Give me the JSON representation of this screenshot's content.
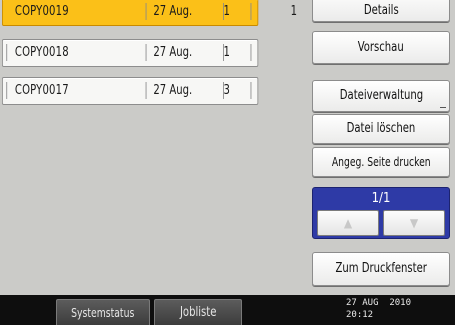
{
  "jobs": [
    {
      "name": "COPY0019",
      "date": "27 Aug.",
      "sets": "1",
      "pages": "1",
      "selected": true
    },
    {
      "name": "COPY0018",
      "date": "27 Aug.",
      "sets": "1",
      "pages": "",
      "selected": false
    },
    {
      "name": "COPY0017",
      "date": "27 Aug.",
      "sets": "3",
      "pages": "",
      "selected": false
    }
  ],
  "buttons": {
    "details": "Details",
    "preview": "Vorschau",
    "file_management": "Dateiverwaltung",
    "delete_file": "Datei löschen",
    "print_pages": "Angeg. Seite drucken",
    "print_window": "Zum Druckfenster"
  },
  "pager": {
    "label": "1/1",
    "up_icon": "▲",
    "down_icon": "▼"
  },
  "statusbar": {
    "system_status": "Systemstatus",
    "job_list": "Jobliste",
    "date": "27 AUG  2010",
    "time": "20:12"
  },
  "colors": {
    "selected_row": "#fbc018",
    "pager": "#2e3aa6",
    "panel": "#cbcbc8",
    "statusbar": "#0e0e0e"
  }
}
